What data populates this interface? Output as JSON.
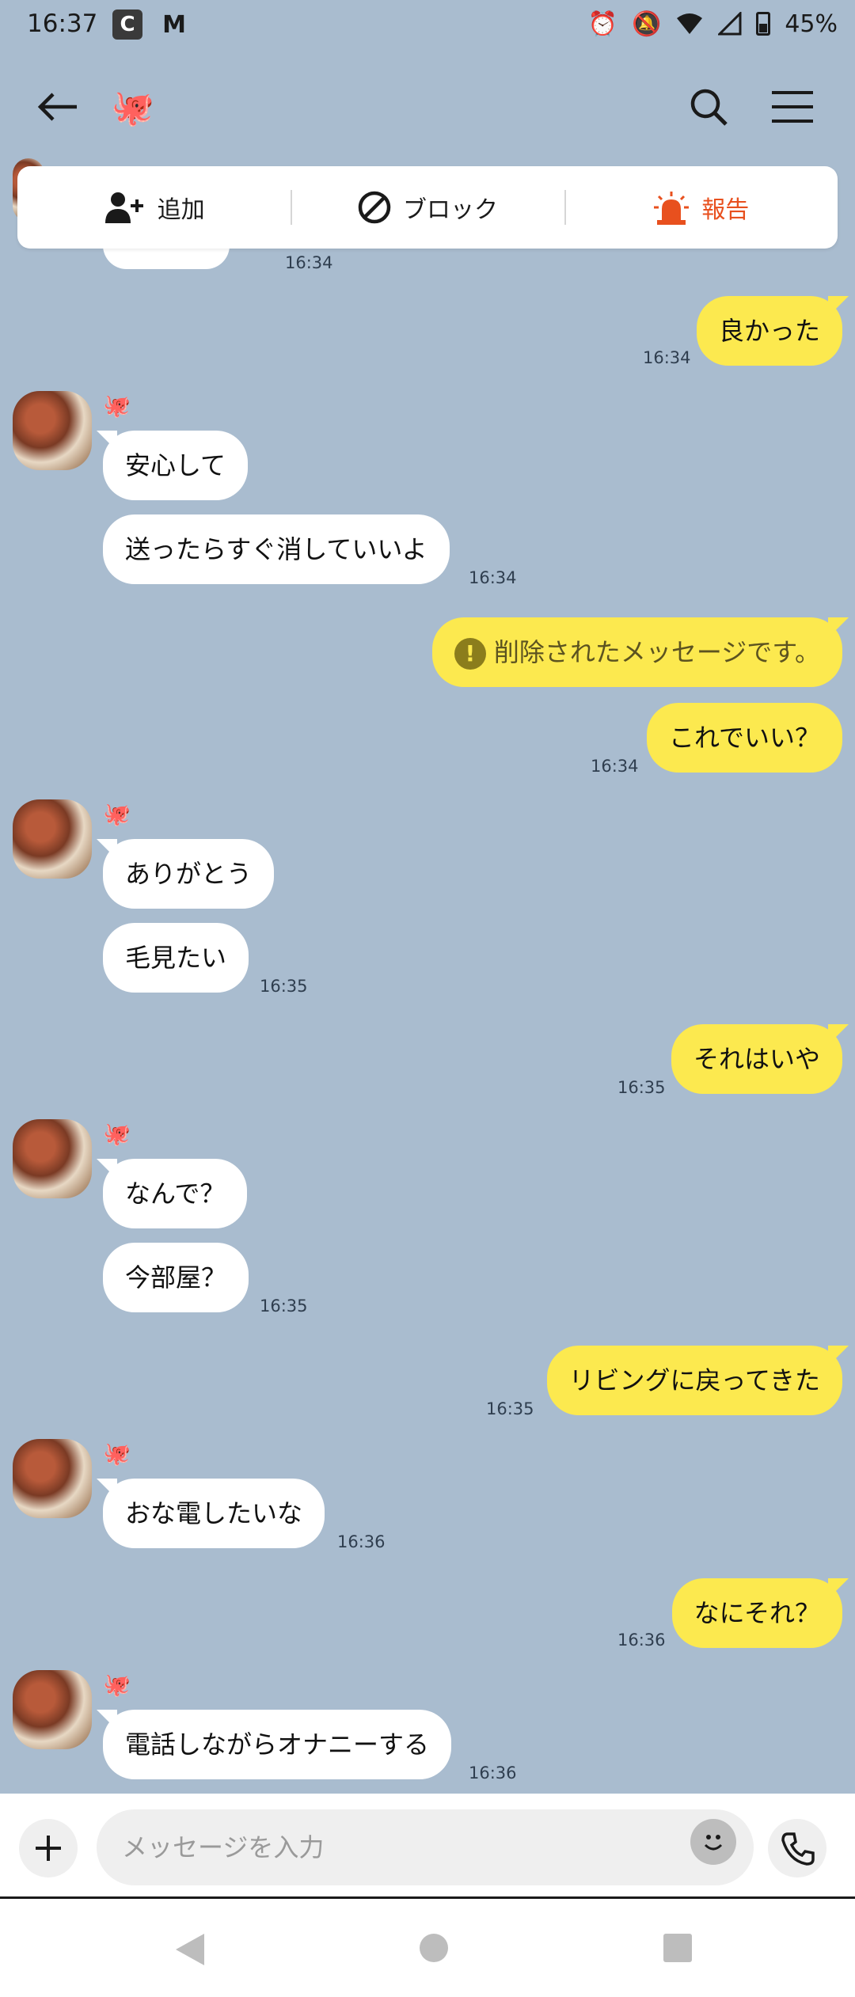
{
  "status": {
    "time": "16:37",
    "battery": "45%",
    "c_icon": "C",
    "m_icon": "M"
  },
  "header": {
    "title_emoji": "🐙"
  },
  "actions": {
    "add": "追加",
    "block": "ブロック",
    "report": "報告"
  },
  "messages": [
    {
      "text": "良かった",
      "time": "16:34"
    },
    {
      "text": "安心して"
    },
    {
      "text": "送ったらすぐ消していいよ",
      "time": "16:34"
    },
    {
      "text": "削除されたメッセージです。"
    },
    {
      "text": "これでいい？",
      "time": "16:34"
    },
    {
      "text": "ありがとう"
    },
    {
      "text": "毛見たい",
      "time": "16:35"
    },
    {
      "text": "それはいや",
      "time": "16:35"
    },
    {
      "text": "なんで？"
    },
    {
      "text": "今部屋？",
      "time": "16:35"
    },
    {
      "text": "リビングに戻ってきた",
      "time": "16:35"
    },
    {
      "text": "おな電したいな",
      "time": "16:36"
    },
    {
      "text": "なにそれ？",
      "time": "16:36"
    },
    {
      "text": "電話しながらオナニーする",
      "time": "16:36"
    }
  ],
  "top_partial_time": "16:34",
  "sender_emoji": "🐙",
  "input": {
    "placeholder": "メッセージを入力"
  }
}
